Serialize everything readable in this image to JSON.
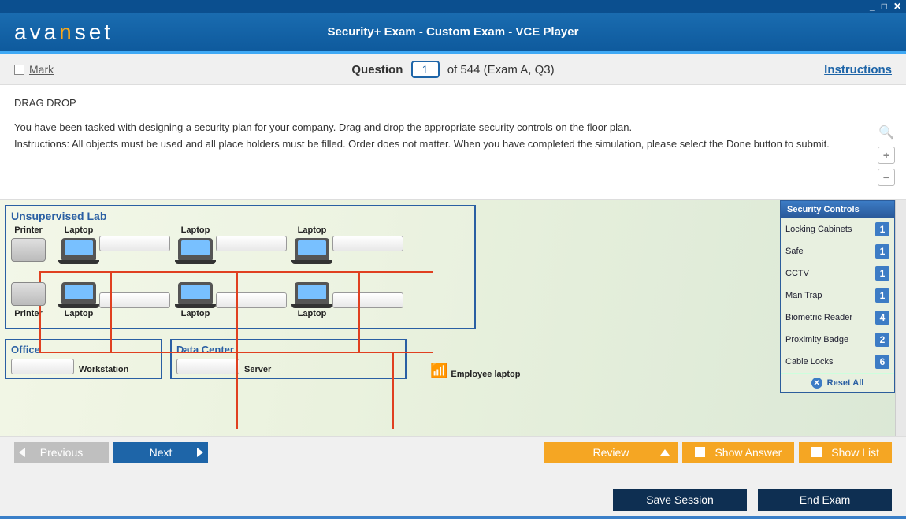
{
  "window": {
    "minimize": "_",
    "maximize": "□",
    "close": "✕"
  },
  "brand": {
    "pre": "ava",
    "mid": "n",
    "post": "set"
  },
  "header_title": "Security+ Exam - Custom Exam - VCE Player",
  "qbar": {
    "mark_label": "Mark",
    "question_word": "Question",
    "current": "1",
    "rest": "of 544 (Exam A, Q3)",
    "instructions": "Instructions"
  },
  "question": {
    "heading": "DRAG DROP",
    "line1": "You have been tasked with designing a security plan for your company. Drag and drop the appropriate security controls on the floor plan.",
    "line2": "Instructions: All objects must be used and all place holders must be filled. Order does not matter. When you have completed the simulation, please select the Done button to submit."
  },
  "zoom": {
    "mag": "🔍",
    "plus": "+",
    "minus": "−"
  },
  "sim": {
    "lab_title": "Unsupervised Lab",
    "devices": {
      "printer": "Printer",
      "laptop": "Laptop",
      "workstation": "Workstation",
      "server": "Server",
      "employee_laptop": "Employee laptop"
    },
    "office": "Office",
    "data_center": "Data Center",
    "sec_header": "Security Controls",
    "controls": [
      {
        "name": "Locking Cabinets",
        "count": "1"
      },
      {
        "name": "Safe",
        "count": "1"
      },
      {
        "name": "CCTV",
        "count": "1"
      },
      {
        "name": "Man Trap",
        "count": "1"
      },
      {
        "name": "Biometric Reader",
        "count": "4"
      },
      {
        "name": "Proximity Badge",
        "count": "2"
      },
      {
        "name": "Cable Locks",
        "count": "6"
      }
    ],
    "reset": "Reset  All"
  },
  "nav": {
    "previous": "Previous",
    "next": "Next",
    "review": "Review",
    "show_answer": "Show Answer",
    "show_list": "Show List"
  },
  "footer": {
    "save": "Save Session",
    "end": "End Exam"
  }
}
